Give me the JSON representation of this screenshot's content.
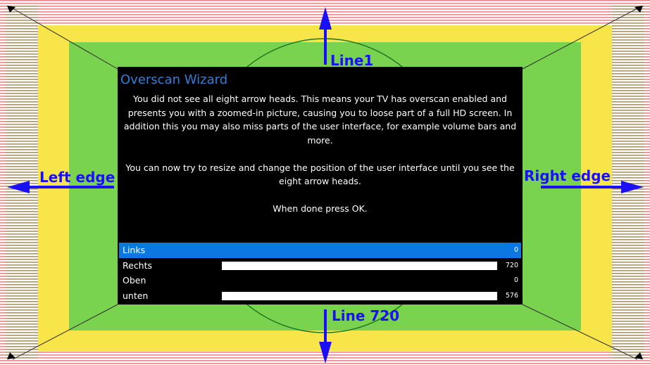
{
  "wizard": {
    "title": "Overscan Wizard",
    "paragraph1": "You did not see all eight arrow heads. This means your TV has overscan enabled and presents you with a zoomed-in picture, causing you to loose part of a full HD screen. In addition this you may also miss parts of the user interface, for example volume bars and more.",
    "paragraph2": "You can now try to resize and change the position of the user interface until you see the eight arrow heads.",
    "paragraph3": "When done press OK.",
    "settings": [
      {
        "label": "Links",
        "value": "0",
        "selected": true,
        "bar": false
      },
      {
        "label": "Rechts",
        "value": "720",
        "selected": false,
        "bar": true
      },
      {
        "label": "Oben",
        "value": "0",
        "selected": false,
        "bar": false
      },
      {
        "label": "unten",
        "value": "576",
        "selected": false,
        "bar": true
      }
    ]
  },
  "labels": {
    "top": "Line1",
    "bottom": "Line 720",
    "left": "Left edge",
    "right": "Right edge"
  },
  "colors": {
    "outer_stripes": "#e28a8a",
    "outer_zone": "#ffffff",
    "yellow_zone": "#f7e54a",
    "green_zone": "#7ad34f",
    "green_stripes": "#2fa82f",
    "arrow_blue": "#1a10f5",
    "selected_row": "#0a78e0",
    "title_blue": "#2f7fd6"
  }
}
